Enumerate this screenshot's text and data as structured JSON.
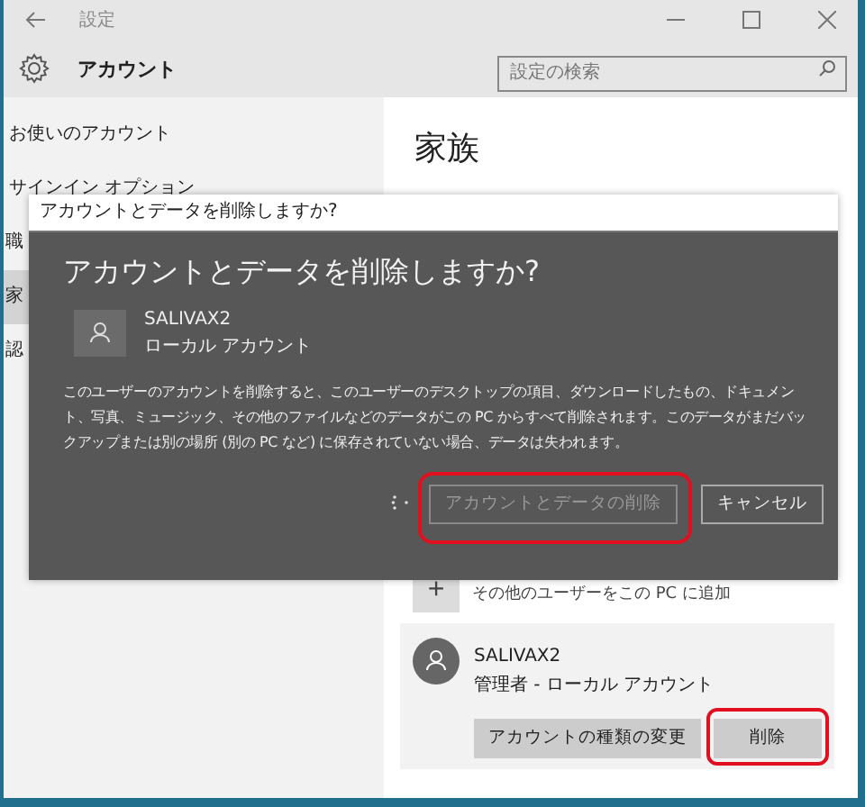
{
  "window": {
    "title": "設定",
    "header": "アカウント"
  },
  "search": {
    "placeholder": "設定の検索"
  },
  "sidebar": {
    "items": [
      {
        "label": "お使いのアカウント",
        "selected": false
      },
      {
        "label": "サインイン オプション",
        "selected": false
      },
      {
        "label": "職",
        "selected": false
      },
      {
        "label": "家",
        "selected": true
      },
      {
        "label": "認",
        "selected": false
      }
    ]
  },
  "content": {
    "heading": "家族",
    "add_user": {
      "icon": "+",
      "label": "その他のユーザーをこの PC に追加"
    },
    "user": {
      "name": "SALIVAX2",
      "role": "管理者 - ローカル アカウント",
      "buttons": [
        {
          "label": "アカウントの種類の変更",
          "highlighted": false
        },
        {
          "label": "削除",
          "highlighted": true
        }
      ]
    }
  },
  "dialog": {
    "title": "アカウントとデータを削除しますか?",
    "heading": "アカウントとデータを削除しますか?",
    "account": {
      "name": "SALIVAX2",
      "type": "ローカル アカウント"
    },
    "message": "このユーザーのアカウントを削除すると、このユーザーのデスクトップの項目、ダウンロードしたもの、ドキュメント、写真、ミュージック、その他のファイルなどのデータがこの PC からすべて削除されます。このデータがまだバックアップまたは別の場所 (別の PC など) に保存されていない場合、データは失われます。",
    "busy": true,
    "buttons": [
      {
        "label": "アカウントとデータの削除",
        "disabled": true,
        "highlighted": true
      },
      {
        "label": "キャンセル",
        "disabled": false,
        "highlighted": false
      }
    ]
  }
}
